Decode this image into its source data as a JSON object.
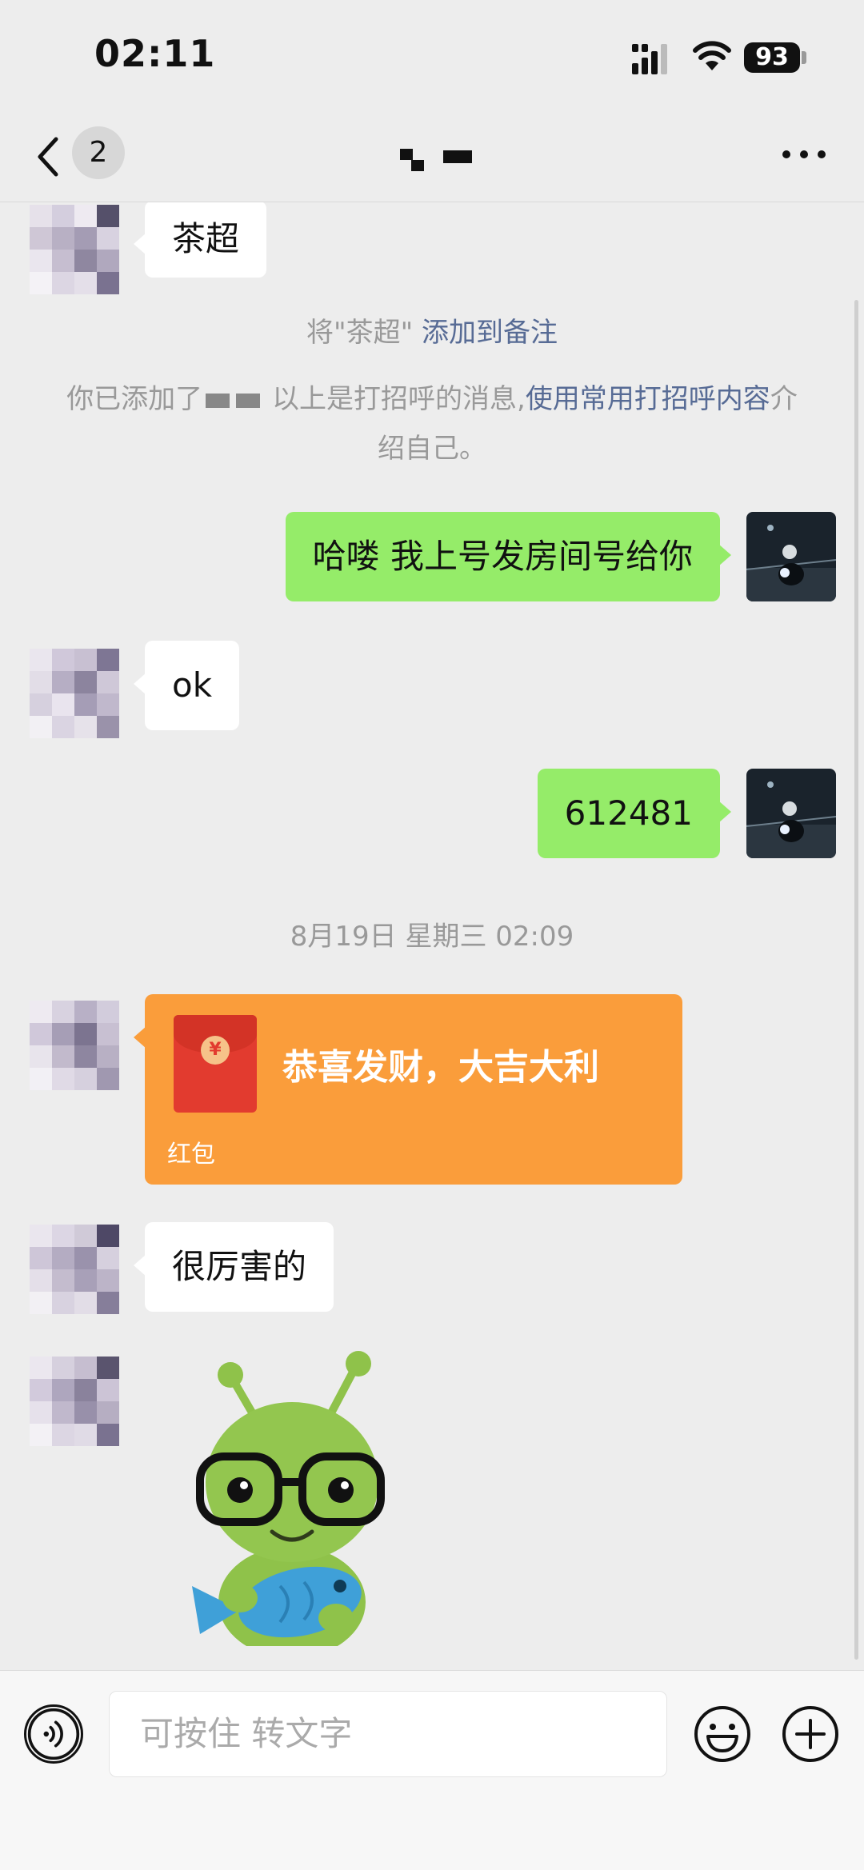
{
  "status_bar": {
    "time": "02:11",
    "battery": "93"
  },
  "nav": {
    "unread_count": "2"
  },
  "messages": {
    "partial_top": "茶超",
    "remark_prefix": "将\"茶超\"",
    "remark_link": "添加到备注",
    "notice_prefix": "你已添加了",
    "notice_middle": "以上是打招呼的消息,",
    "notice_link": "使用常用打招呼内容",
    "notice_suffix": "介绍自己。",
    "out_1": "哈喽 我上号发房间号给你",
    "in_ok": "ok",
    "out_2": "612481",
    "timestamp": "8月19日 星期三 02:09",
    "red_packet_text": "恭喜发财，大吉大利",
    "red_packet_label": "红包",
    "red_packet_coin": "¥",
    "in_last": "很厉害的"
  },
  "input_bar": {
    "placeholder": "可按住 转文字"
  },
  "colors": {
    "green_bubble": "#95ec69",
    "link": "#576b95",
    "red_packet": "#fa9d3b",
    "background": "#ededed"
  }
}
